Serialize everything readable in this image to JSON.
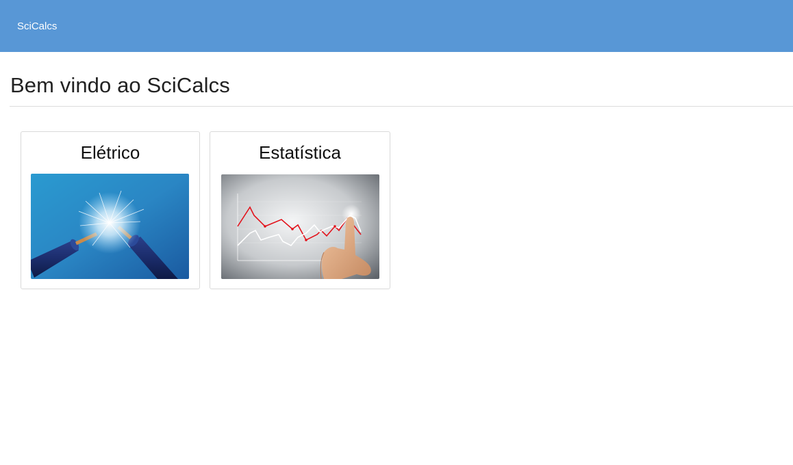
{
  "navbar": {
    "brand": "SciCalcs"
  },
  "main": {
    "title": "Bem vindo ao SciCalcs",
    "cards": [
      {
        "title": "Elétrico",
        "image_icon": "cut-electric-cable-icon"
      },
      {
        "title": "Estatística",
        "image_icon": "line-chart-hand-icon"
      }
    ]
  }
}
